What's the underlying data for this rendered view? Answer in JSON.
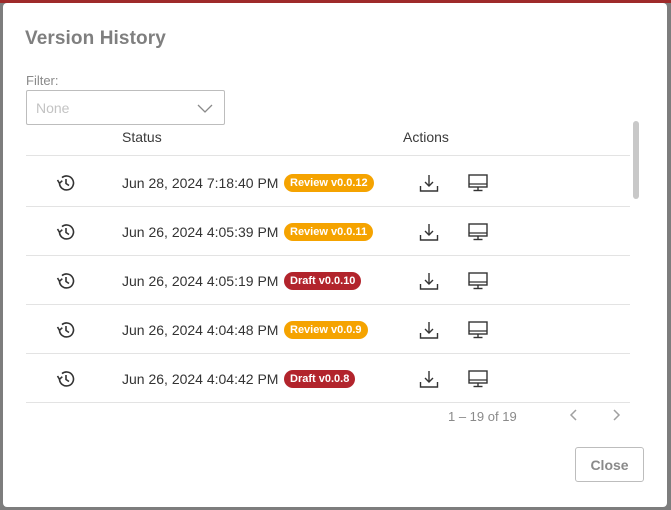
{
  "dialog": {
    "title": "Version History"
  },
  "filter": {
    "label": "Filter:",
    "value": "None"
  },
  "table": {
    "columns": {
      "status": "Status",
      "actions": "Actions"
    },
    "rows": [
      {
        "date": "Jun 28, 2024 7:18:40 PM",
        "badge": "Review v0.0.12",
        "badge_type": "review"
      },
      {
        "date": "Jun 26, 2024 4:05:39 PM",
        "badge": "Review v0.0.11",
        "badge_type": "review"
      },
      {
        "date": "Jun 26, 2024 4:05:19 PM",
        "badge": "Draft v0.0.10",
        "badge_type": "draft"
      },
      {
        "date": "Jun 26, 2024 4:04:48 PM",
        "badge": "Review v0.0.9",
        "badge_type": "review"
      },
      {
        "date": "Jun 26, 2024 4:04:42 PM",
        "badge": "Draft v0.0.8",
        "badge_type": "draft"
      }
    ]
  },
  "pagination": {
    "range": "1 – 19 of 19"
  },
  "footer": {
    "close_label": "Close"
  },
  "icons": {
    "restore": "history-icon",
    "download": "download-icon",
    "preview": "monitor-icon",
    "prev": "chevron-left-icon",
    "next": "chevron-right-icon",
    "dropdown": "chevron-down-icon"
  },
  "colors": {
    "review_badge": "#f5a300",
    "draft_badge": "#b2242c"
  }
}
